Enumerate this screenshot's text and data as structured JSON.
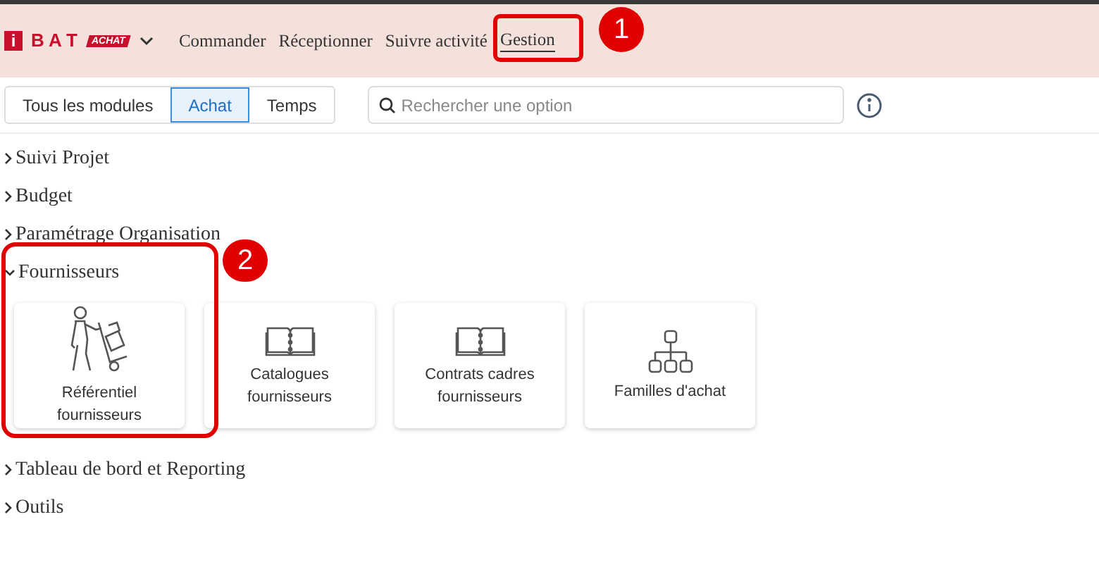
{
  "logo": {
    "letter": "i",
    "name": "B A T",
    "badge": "ACHAT"
  },
  "nav": [
    {
      "label": "Commander",
      "selected": false
    },
    {
      "label": "Réceptionner",
      "selected": false
    },
    {
      "label": "Suivre activité",
      "selected": false
    },
    {
      "label": "Gestion",
      "selected": true
    }
  ],
  "module_tabs": [
    {
      "label": "Tous les modules",
      "selected": false
    },
    {
      "label": "Achat",
      "selected": true
    },
    {
      "label": "Temps",
      "selected": false
    }
  ],
  "search": {
    "placeholder": "Rechercher une option"
  },
  "sections": [
    {
      "title": "Suivi Projet",
      "expanded": false
    },
    {
      "title": "Budget",
      "expanded": false
    },
    {
      "title": "Paramétrage Organisation",
      "expanded": false
    },
    {
      "title": "Fournisseurs",
      "expanded": true,
      "cards": [
        {
          "label": "Référentiel fournisseurs",
          "kind": "delivery"
        },
        {
          "label": "Catalogues fournisseurs",
          "kind": "book"
        },
        {
          "label": "Contrats cadres fournisseurs",
          "kind": "book"
        },
        {
          "label": "Familles d'achat",
          "kind": "hierarchy"
        }
      ]
    },
    {
      "title": "Tableau de bord et Reporting",
      "expanded": false
    },
    {
      "title": "Outils",
      "expanded": false
    }
  ],
  "annotations": [
    "1",
    "2"
  ]
}
